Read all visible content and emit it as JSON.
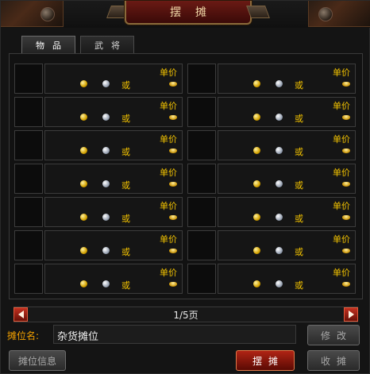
{
  "window": {
    "title": "摆摊"
  },
  "tabs": [
    {
      "label": "物品",
      "active": true
    },
    {
      "label": "武将",
      "active": false
    }
  ],
  "slot_labels": {
    "price": "单价",
    "or": "或"
  },
  "slots": [
    {
      "id": 1
    },
    {
      "id": 2
    },
    {
      "id": 3
    },
    {
      "id": 4
    },
    {
      "id": 5
    },
    {
      "id": 6
    },
    {
      "id": 7
    },
    {
      "id": 8
    },
    {
      "id": 9
    },
    {
      "id": 10
    },
    {
      "id": 11
    },
    {
      "id": 12
    },
    {
      "id": 13
    },
    {
      "id": 14
    }
  ],
  "pager": {
    "text": "1/5页",
    "current": 1,
    "total": 5
  },
  "stall": {
    "name_label": "摊位名:",
    "name_value": "杂货摊位"
  },
  "buttons": {
    "modify": "修改",
    "stall_info": "摊位信息",
    "set_stall": "摆摊",
    "close_stall": "收摊"
  },
  "icons": {
    "gold": "gold-coin-icon",
    "silver": "silver-coin-icon",
    "ingot": "gold-ingot-icon"
  },
  "colors": {
    "price_text": "#f2c200",
    "label_orange": "#f2a000",
    "primary_button": "#b02414",
    "pager_button": "#c23020"
  }
}
